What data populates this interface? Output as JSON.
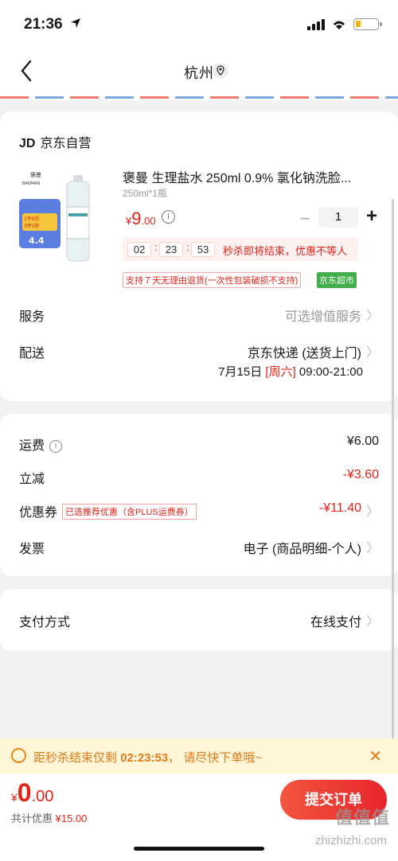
{
  "status_bar": {
    "time": "21:36"
  },
  "nav": {
    "title": "杭州"
  },
  "shop": {
    "logo": "JD",
    "name": "京东自营"
  },
  "product": {
    "title": "褒曼  生理盐水 250ml 0.9% 氯化钠洗脸...",
    "spec": "250ml*1瓶",
    "price_symbol": "¥",
    "price_int": "9",
    "price_dec": ".00",
    "qty": "1",
    "image_brand": "褒曼",
    "image_brand_en": "BAOMAN",
    "image_badge_1": "1件6折",
    "image_badge_2": "3件5折",
    "image_rating": "4.4"
  },
  "countdown": {
    "hh": "02",
    "mm": "23",
    "ss": "53",
    "text": "秒杀即将结束，优惠不等人"
  },
  "tags": {
    "return_policy": "支持７天无理由退货(一次性包装破损不支持)",
    "supermarket": "京东超市"
  },
  "service": {
    "label": "服务",
    "value": "可选增值服务"
  },
  "delivery": {
    "label": "配送",
    "value": "京东快递 (送货上门)",
    "date": "7月15日",
    "weekday": "[周六]",
    "time_range": "09:00-21:00"
  },
  "fees": {
    "shipping": {
      "label": "运费",
      "value": "¥6.00"
    },
    "discount": {
      "label": "立减",
      "value": "-¥3.60"
    },
    "coupon": {
      "label": "优惠券",
      "tag": "已选推荐优惠（含PLUS运费券）",
      "value": "-¥11.40"
    },
    "invoice": {
      "label": "发票",
      "value": "电子 (商品明细-个人)"
    }
  },
  "payment": {
    "label": "支付方式",
    "value": "在线支付"
  },
  "banner": {
    "prefix": "距秒杀结束仅剩",
    "time": "02:23:53",
    "suffix": "， 请尽快下单哦~"
  },
  "bottom": {
    "currency": "¥",
    "total_int": "0",
    "total_dec": ".00",
    "savings_label": "共计优惠",
    "savings_value": "¥15.00",
    "submit_label": "提交订单"
  },
  "watermark": {
    "cn": "值值值",
    "url": "zhizhizhi.com"
  },
  "colors": {
    "accent": "#e2231a",
    "banner_bg": "#fff6d8",
    "banner_text": "#e27b1a",
    "green_tag": "#3fae4a"
  }
}
